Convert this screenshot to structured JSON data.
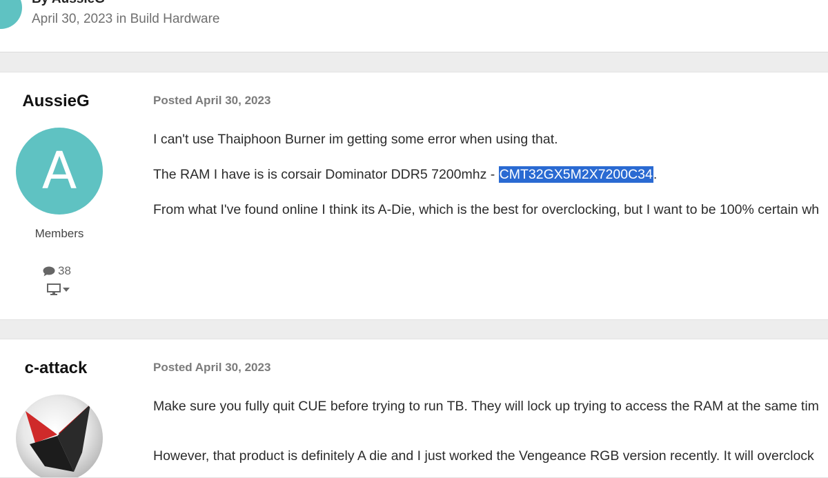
{
  "topic_header": {
    "byline": "By AussieG",
    "date": "April 30, 2023",
    "in_word": "in",
    "forum": "Build Hardware"
  },
  "posts": [
    {
      "author": "AussieG",
      "avatar_letter": "A",
      "avatar_color": "#5fc2c2",
      "group": "Members",
      "post_count": "38",
      "posted_label": "Posted",
      "date": "April 30, 2023",
      "body": {
        "p1": "I can't use Thaiphoon Burner im getting some error when using that.",
        "p2_before": "The RAM I have is is corsair Dominator DDR5 7200mhz - ",
        "p2_highlight": "CMT32GX5M2X7200C34",
        "p2_after": ".",
        "p3": "From what I've found online I think its A-Die, which is the best for overclocking, but I want to be 100% certain wh"
      }
    },
    {
      "author": "c-attack",
      "posted_label": "Posted",
      "date": "April 30, 2023",
      "body": {
        "p1": "Make sure you fully quit CUE before trying to run TB. They will lock up trying to access the RAM at the same tim",
        "p2": "However, that product is definitely A die and I just worked the Vengeance RGB version recently. It will overclock"
      }
    }
  ],
  "colors": {
    "highlight": "#2a6ad2",
    "avatar_teal": "#5fc2c2",
    "page_bg": "#ededed"
  },
  "icons": {
    "post_count": "speech-bubble-icon",
    "device": "monitor-icon",
    "dropdown": "caret-down-icon"
  }
}
